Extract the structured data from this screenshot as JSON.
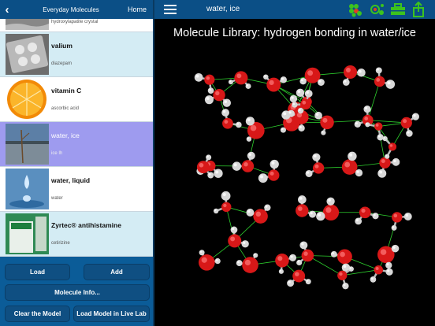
{
  "left_nav": {
    "back_icon": "chevron-left",
    "title": "Everyday Molecules",
    "home": "Home"
  },
  "molecules": [
    {
      "name": "",
      "subtitle": "hydroxylapatite crystal",
      "selected": false,
      "thumb": "bone-photo"
    },
    {
      "name": "valium",
      "subtitle": "diazepam",
      "selected": false,
      "thumb": "pill-blister-photo"
    },
    {
      "name": "vitamin C",
      "subtitle": "ascorbic acid",
      "selected": false,
      "thumb": "orange-slice-photo"
    },
    {
      "name": "water, ice",
      "subtitle": "ice Ih",
      "selected": true,
      "thumb": "frozen-lake-photo"
    },
    {
      "name": "water, liquid",
      "subtitle": "water",
      "selected": false,
      "thumb": "water-drop-photo"
    },
    {
      "name": "Zyrtec® antihistamine",
      "subtitle": "cetirizine",
      "selected": false,
      "thumb": "allergy-box-photo"
    }
  ],
  "buttons": {
    "load": "Load",
    "add": "Add",
    "info": "Molecule Info...",
    "clear": "Clear the Model",
    "live": "Load Model in Live Lab"
  },
  "right_nav": {
    "title": "water, ice",
    "icons": [
      "menu-icon",
      "molecule-grid-icon",
      "rotate-molecule-icon",
      "toolbox-icon",
      "share-icon"
    ]
  },
  "viewer": {
    "heading": "Molecule Library: hydrogen bonding in water/ice"
  },
  "colors": {
    "nav": "#0b4f86",
    "panel": "#0b5c98",
    "selected_row": "#9e9bef",
    "tint_row": "#d4ecf4",
    "oxygen": "#d81818",
    "hydrogen": "#d8d8d8",
    "hbond": "#2ed12e",
    "icon_green": "#3cc31e"
  }
}
